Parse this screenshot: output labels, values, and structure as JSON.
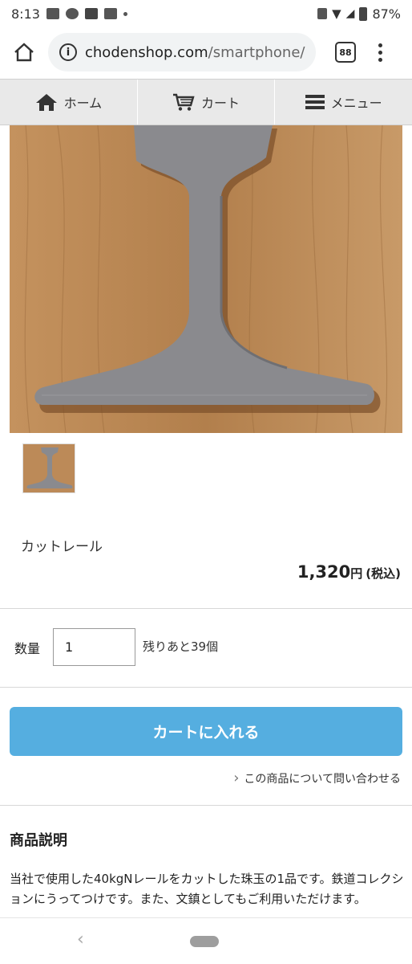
{
  "status_bar": {
    "time": "8:13",
    "battery": "87%"
  },
  "browser": {
    "url_domain": "chodenshop.com",
    "url_path": "/smartphone/",
    "tab_count": "88"
  },
  "nav": {
    "home_label": "ホーム",
    "cart_label": "カート",
    "menu_label": "メニュー"
  },
  "product": {
    "name": "カットレール",
    "price": "1,320",
    "currency": "円",
    "tax_note": "(税込)"
  },
  "quantity": {
    "label": "数量",
    "value": "1",
    "stock": "残りあと39個"
  },
  "actions": {
    "add_to_cart": "カートに入れる",
    "inquiry": "この商品について問い合わせる"
  },
  "description": {
    "heading": "商品説明",
    "text": "当社で使用した40kgNレールをカットした珠玉の1品です。鉄道コレクションにうってつけです。また、文鎮としてもご利用いただけます。"
  },
  "colors": {
    "accent": "#55aee0",
    "nav_bg": "#e9e9e9",
    "wood": "#b98755",
    "steel": "#8a8a8e"
  }
}
